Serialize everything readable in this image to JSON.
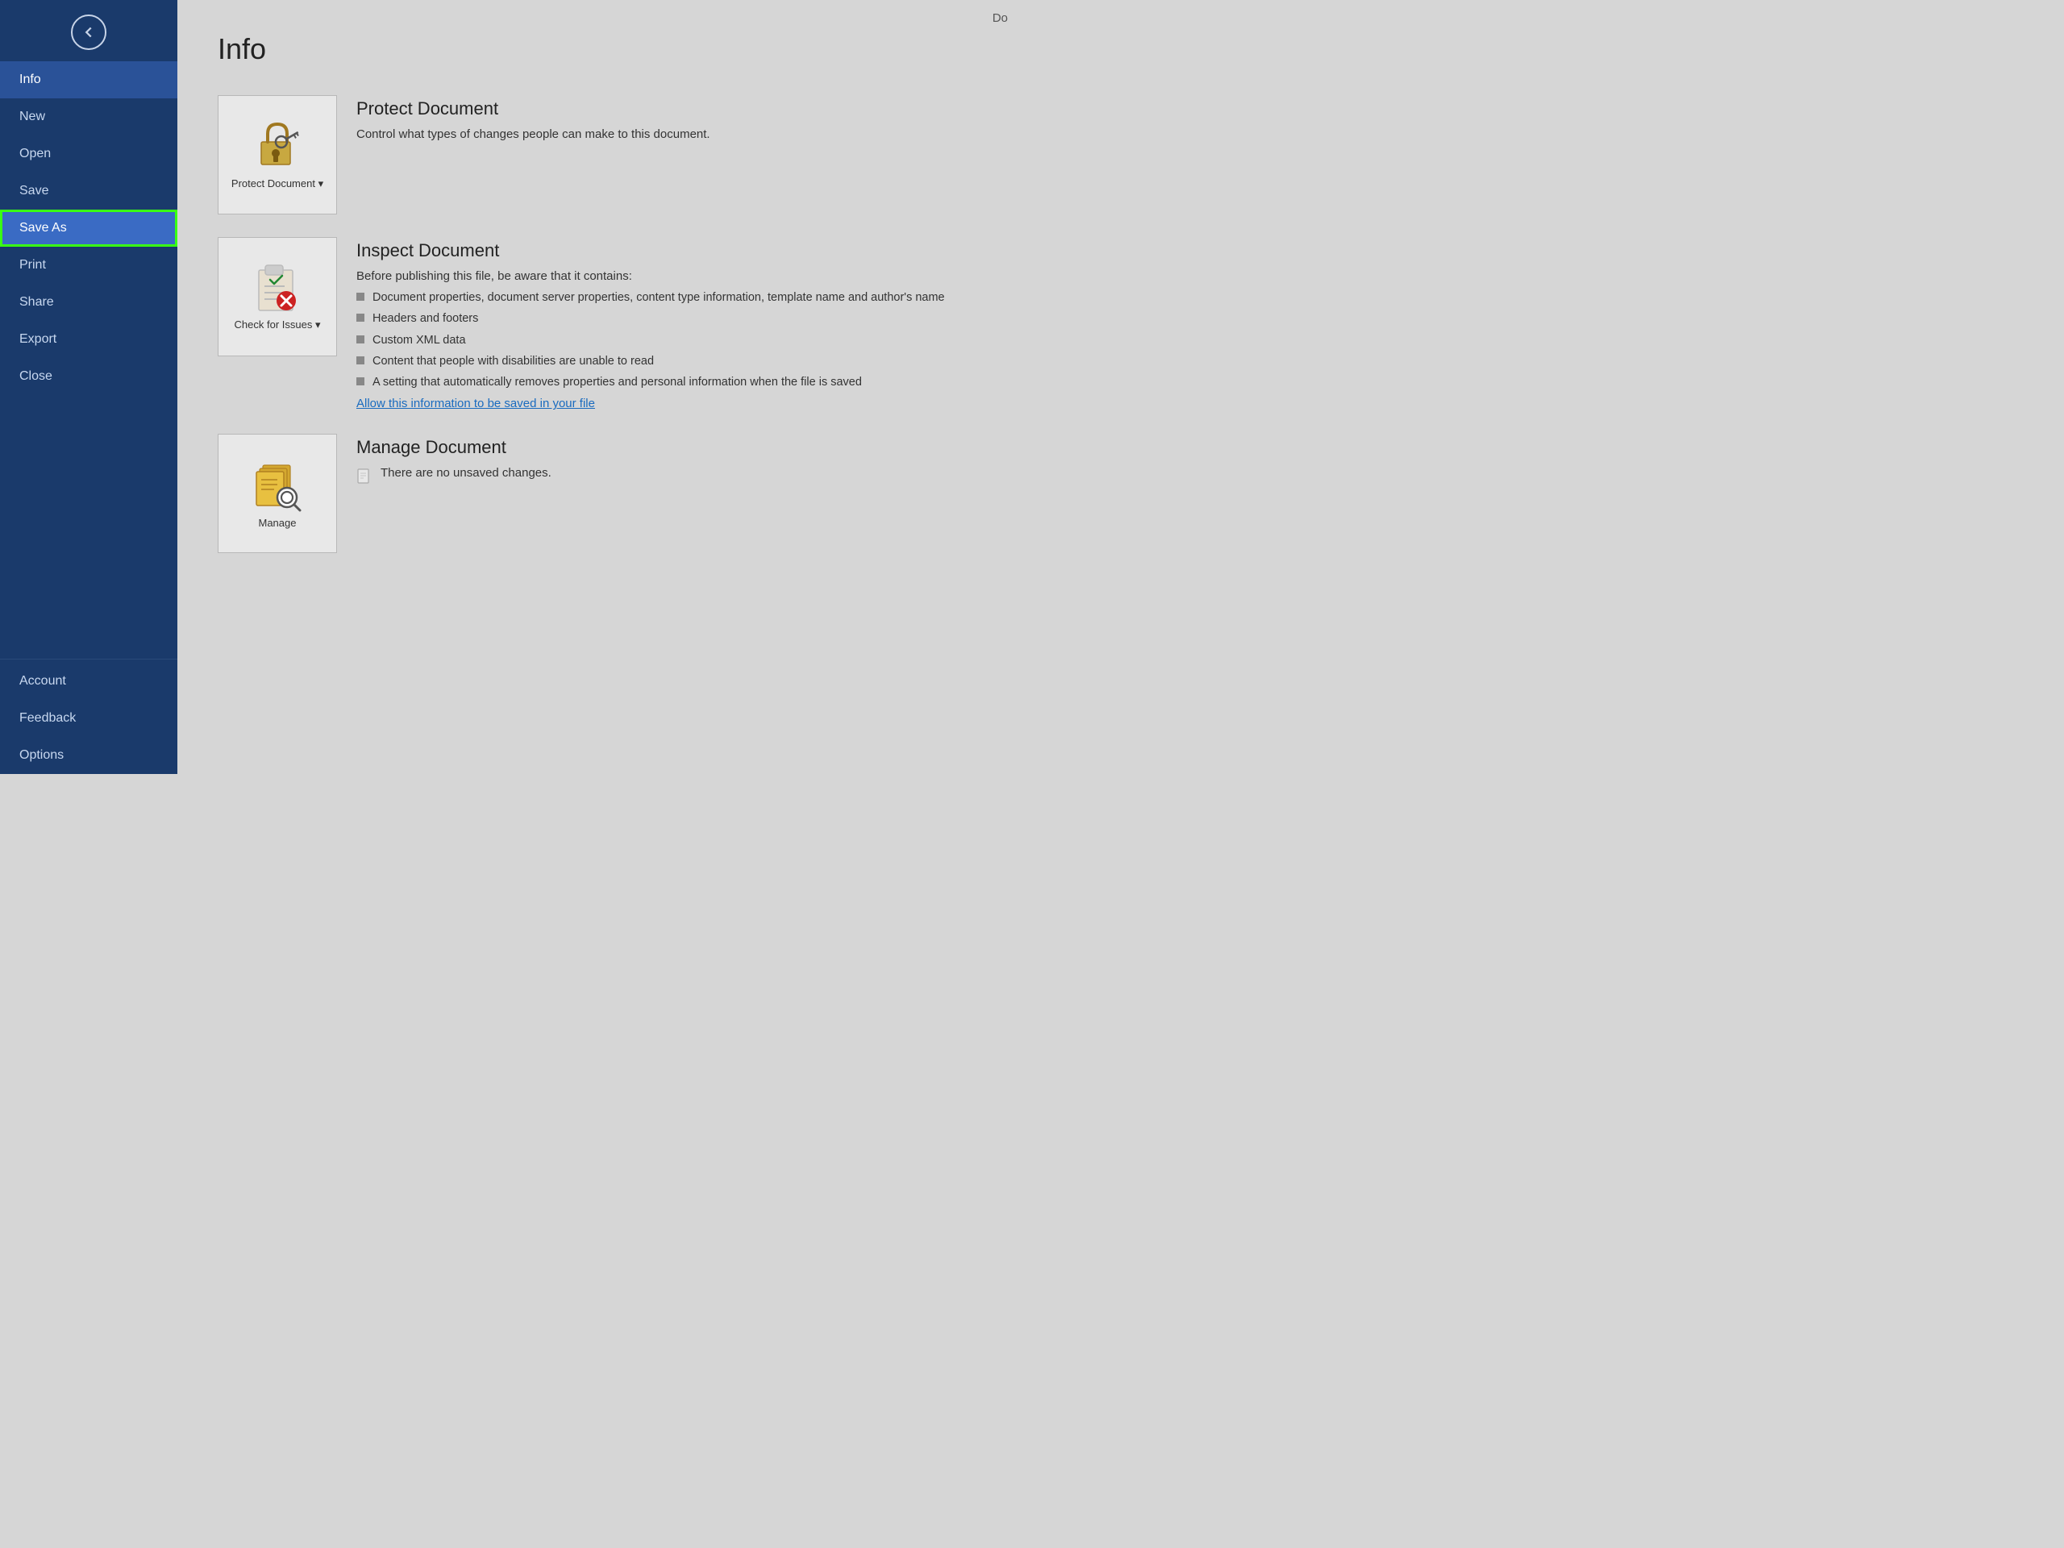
{
  "doc_title_partial": "Do",
  "page_title": "Info",
  "back_button_label": "Back",
  "nav": {
    "items": [
      {
        "id": "info",
        "label": "Info",
        "state": "active"
      },
      {
        "id": "new",
        "label": "New",
        "state": "normal"
      },
      {
        "id": "open",
        "label": "Open",
        "state": "normal"
      },
      {
        "id": "save",
        "label": "Save",
        "state": "normal"
      },
      {
        "id": "save-as",
        "label": "Save As",
        "state": "highlighted"
      },
      {
        "id": "print",
        "label": "Print",
        "state": "normal"
      },
      {
        "id": "share",
        "label": "Share",
        "state": "normal"
      },
      {
        "id": "export",
        "label": "Export",
        "state": "normal"
      },
      {
        "id": "close",
        "label": "Close",
        "state": "normal"
      }
    ],
    "bottom_items": [
      {
        "id": "account",
        "label": "Account",
        "state": "normal"
      },
      {
        "id": "feedback",
        "label": "Feedback",
        "state": "normal"
      },
      {
        "id": "options",
        "label": "Options",
        "state": "normal"
      }
    ]
  },
  "cards": {
    "protect": {
      "icon_label": "Protect\nDocument ▾",
      "title": "Protect Document",
      "description": "Control what types of changes people can make to this document."
    },
    "inspect": {
      "icon_label": "Check for\nIssues ▾",
      "title": "Inspect Document",
      "description": "Before publishing this file, be aware that it contains:",
      "list_items": [
        "Document properties, document server properties, content type information, template name and author's name",
        "Headers and footers",
        "Custom XML data",
        "Content that people with disabilities are unable to read",
        "A setting that automatically removes properties and personal information when the file is saved"
      ],
      "link_text": "Allow this information to be saved in your file"
    },
    "manage": {
      "icon_label": "Manage",
      "title": "Manage Document",
      "description": "There are no unsaved changes."
    }
  }
}
